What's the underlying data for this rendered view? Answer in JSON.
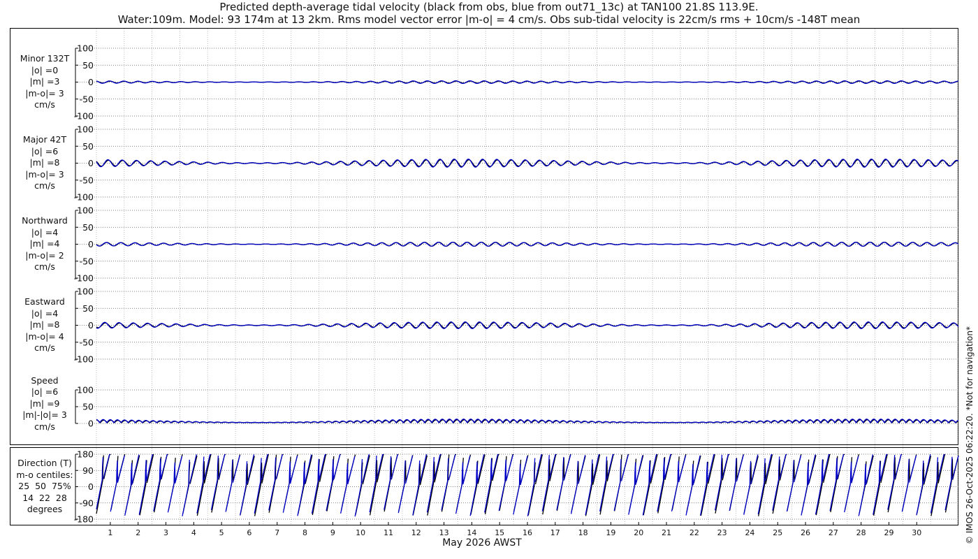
{
  "title": {
    "line1": "Predicted depth-average tidal velocity (black from obs, blue from out71_13c) at TAN100 21.8S 113.9E.",
    "line2": "Water:109m. Model: 93 174m at 13 2km. Rms model vector error |m-o| = 4 cm/s. Obs sub-tidal velocity is 22cm/s rms + 10cm/s -148T mean"
  },
  "credit": "© IMOS 26-Oct-2025 06:22:20. *Not for navigation*",
  "colors": {
    "obs": "#000000",
    "model": "#0000cc",
    "grid": "#b0b0b0"
  },
  "chart_data": [
    {
      "type": "line",
      "id": "minor",
      "label_lines": [
        "Minor 132T",
        "|o| =0",
        "|m| =3",
        "|m-o|= 3",
        "cm/s"
      ],
      "ylim": [
        -100,
        100
      ],
      "yticks": [
        -100,
        -50,
        0,
        50,
        100
      ],
      "amp_obs": 3,
      "amp_model": 4,
      "series": [
        {
          "role": "obs"
        },
        {
          "role": "model"
        }
      ]
    },
    {
      "type": "line",
      "id": "major",
      "label_lines": [
        "Major 42T",
        "|o| =6",
        "|m| =8",
        "|m-o|= 3",
        "cm/s"
      ],
      "ylim": [
        -100,
        100
      ],
      "yticks": [
        -100,
        -50,
        0,
        50,
        100
      ],
      "amp_obs": 10,
      "amp_model": 12,
      "series": [
        {
          "role": "obs"
        },
        {
          "role": "model"
        }
      ]
    },
    {
      "type": "line",
      "id": "northward",
      "label_lines": [
        "Northward",
        "|o| =4",
        "|m| =4",
        "|m-o|= 2",
        "cm/s"
      ],
      "ylim": [
        -100,
        100
      ],
      "yticks": [
        -100,
        -50,
        0,
        50,
        100
      ],
      "amp_obs": 6,
      "amp_model": 6,
      "series": [
        {
          "role": "obs"
        },
        {
          "role": "model"
        }
      ]
    },
    {
      "type": "line",
      "id": "eastward",
      "label_lines": [
        "Eastward",
        "|o| =4",
        "|m| =8",
        "|m-o|= 4",
        "cm/s"
      ],
      "ylim": [
        -100,
        100
      ],
      "yticks": [
        -100,
        -50,
        0,
        50,
        100
      ],
      "amp_obs": 8,
      "amp_model": 10,
      "series": [
        {
          "role": "obs"
        },
        {
          "role": "model"
        }
      ]
    },
    {
      "type": "line",
      "id": "speed",
      "label_lines": [
        "Speed",
        "|o| =6",
        "|m| =9",
        "|m|-|o|= 3",
        "cm/s"
      ],
      "ylim": [
        0,
        100
      ],
      "yticks": [
        0,
        50,
        100
      ],
      "amp_obs": 8,
      "amp_model": 10,
      "series": [
        {
          "role": "obs"
        },
        {
          "role": "model"
        }
      ]
    },
    {
      "type": "line",
      "id": "direction",
      "label_lines": [
        "Direction (T)",
        "m-o centiles:",
        "25  50  75%",
        "14  22  28",
        "degrees"
      ],
      "ylim": [
        -180,
        180
      ],
      "yticks": [
        -180,
        -90,
        0,
        90,
        180
      ],
      "series": [
        {
          "role": "obs"
        },
        {
          "role": "model"
        }
      ]
    }
  ],
  "xaxis": {
    "label": "May 2026 AWST",
    "days": 31,
    "tick_labels": [
      "1",
      "2",
      "3",
      "4",
      "5",
      "6",
      "7",
      "8",
      "9",
      "10",
      "11",
      "12",
      "13",
      "14",
      "15",
      "16",
      "17",
      "18",
      "19",
      "20",
      "21",
      "22",
      "23",
      "24",
      "25",
      "26",
      "27",
      "28",
      "29",
      "30"
    ]
  }
}
